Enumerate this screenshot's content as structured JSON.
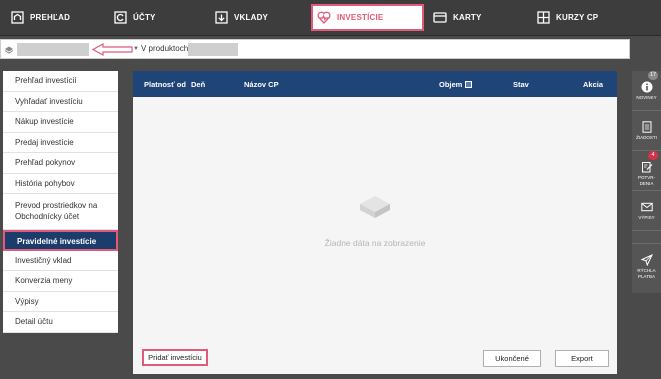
{
  "nav": {
    "items": [
      {
        "label": "PREHĽAD",
        "icon": "home-icon"
      },
      {
        "label": "ÚČTY",
        "icon": "accounts-icon"
      },
      {
        "label": "VKLADY",
        "icon": "deposits-icon"
      },
      {
        "label": "INVESTÍCIE",
        "icon": "investments-icon",
        "active": true
      },
      {
        "label": "KARTY",
        "icon": "card-icon"
      },
      {
        "label": "KURZY CP",
        "icon": "grid-icon"
      }
    ]
  },
  "product_bar": {
    "in_products_label": "V produktoch"
  },
  "sidebar": {
    "items": [
      {
        "label": "Prehľad investícií"
      },
      {
        "label": "Vyhľadať investíciu"
      },
      {
        "label": "Nákup investície"
      },
      {
        "label": "Predaj investície"
      },
      {
        "label": "Prehľad pokynov"
      },
      {
        "label": "História pohybov"
      },
      {
        "label": "Prevod prostriedkov na Obchodnícky účet"
      },
      {
        "label": "Pravidelné investície",
        "active": true
      },
      {
        "label": "Investičný vklad"
      },
      {
        "label": "Konverzia meny"
      },
      {
        "label": "Výpisy"
      },
      {
        "label": "Detail účtu"
      }
    ]
  },
  "table": {
    "columns": [
      "Platnosť od",
      "Deň",
      "Názov CP",
      "Objem",
      "Stav",
      "Akcia"
    ],
    "empty_text": "Žiadne dáta na zobrazenie"
  },
  "buttons": {
    "add": "Pridať investíciu",
    "ended": "Ukončené",
    "export": "Export"
  },
  "rail": {
    "items": [
      {
        "label": "NOVINKY",
        "icon": "info-icon",
        "badge": "17",
        "badge_color": "#8a8a8a"
      },
      {
        "label": "ŽIADOSTI",
        "icon": "document-icon"
      },
      {
        "label": "POTVR-DENIA",
        "icon": "confirm-icon",
        "badge": "4",
        "badge_color": "#d6334a"
      },
      {
        "label": "VÝPISY",
        "icon": "mail-icon"
      },
      {
        "label": "RÝCHLA PLATBA",
        "icon": "send-icon"
      }
    ]
  },
  "colors": {
    "accent": "#e05a7a",
    "table_header": "#1f4578",
    "sidebar_active": "#1c3d6b",
    "topnav_bg": "#3d3d3d"
  }
}
